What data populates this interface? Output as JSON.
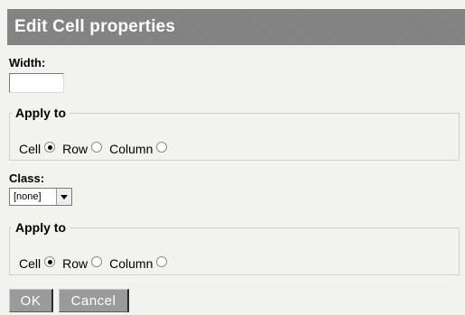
{
  "dialog": {
    "title": "Edit Cell properties"
  },
  "width_field": {
    "label": "Width:",
    "value": ""
  },
  "width_apply": {
    "legend": "Apply to",
    "options": [
      {
        "label": "Cell",
        "checked": true
      },
      {
        "label": "Row",
        "checked": false
      },
      {
        "label": "Column",
        "checked": false
      }
    ]
  },
  "class_field": {
    "label": "Class:",
    "selected": "[none]"
  },
  "class_apply": {
    "legend": "Apply to",
    "options": [
      {
        "label": "Cell",
        "checked": true
      },
      {
        "label": "Row",
        "checked": false
      },
      {
        "label": "Column",
        "checked": false
      }
    ]
  },
  "buttons": {
    "ok": "OK",
    "cancel": "Cancel"
  },
  "colors": {
    "title_bar": "#818181",
    "background": "#f2f2ee",
    "button": "#9a9a9a"
  }
}
